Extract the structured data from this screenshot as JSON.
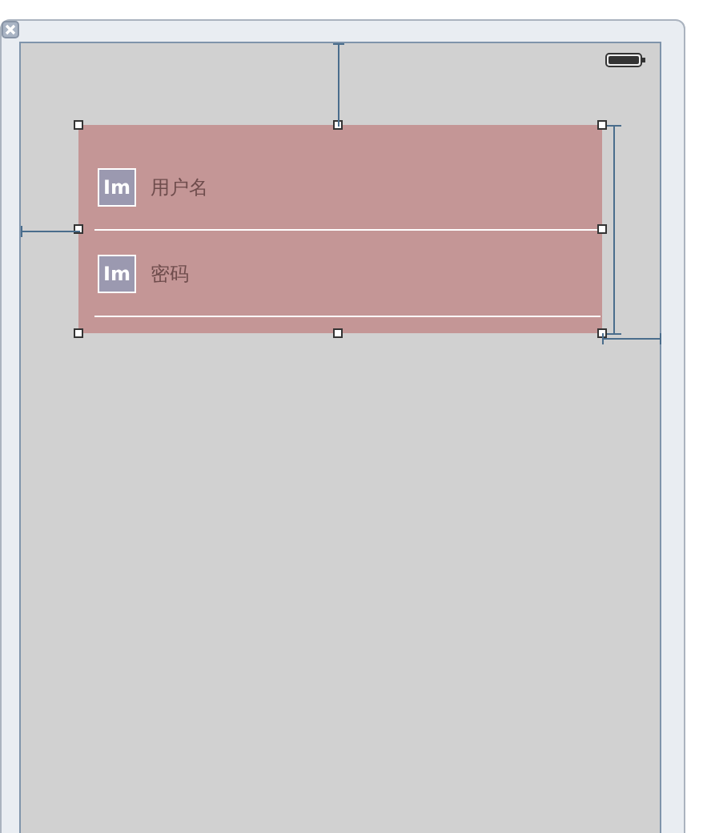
{
  "form": {
    "fields": [
      {
        "image_label": "Im",
        "placeholder": "用户名"
      },
      {
        "image_label": "Im",
        "placeholder": "密码"
      }
    ],
    "selected": true
  }
}
